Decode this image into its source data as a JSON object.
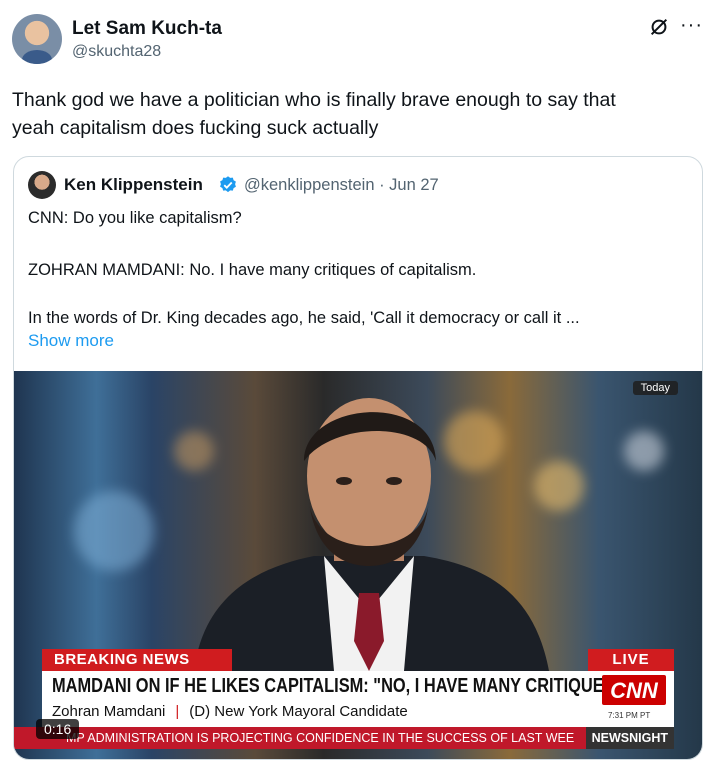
{
  "author": {
    "name": "Let Sam Kuch-ta",
    "handle": "@skuchta28"
  },
  "tweet": {
    "line1": "Thank god we have a politician who is finally brave enough to say that",
    "line2": "yeah capitalism does fucking suck actually"
  },
  "quote": {
    "name": "Ken Klippenstein",
    "handle_date": "@kenklippenstein · Jun 27",
    "line1": "CNN: Do you like capitalism?",
    "line2": "ZOHRAN MAMDANI: No. I have many critiques of capitalism.",
    "line3": "In the words of Dr. King decades ago, he said, 'Call it democracy or call it ...",
    "show_more": "Show more"
  },
  "video": {
    "today": "Today",
    "breaking": "BREAKING NEWS",
    "live": "LIVE",
    "headline": "MAMDANI ON IF HE LIKES CAPITALISM: \"NO, I HAVE MANY CRITIQUES\"",
    "sub_name": "Zohran Mamdani",
    "sub_sep": "|",
    "sub_role": "(D) New York Mayoral Candidate",
    "clock": "7:31 PM PT",
    "ticker": "MP ADMINISTRATION IS PROJECTING CONFIDENCE IN THE SUCCESS OF LAST WEE",
    "show": "NEWSNIGHT",
    "timer": "0:16",
    "logo": "CNN"
  },
  "icons": {
    "grok": "grok-icon",
    "more": "more-icon",
    "verified": "verified-badge-icon"
  },
  "colors": {
    "link": "#1d9bf0",
    "cnn_red": "#cc0000",
    "secondary": "#536471"
  }
}
